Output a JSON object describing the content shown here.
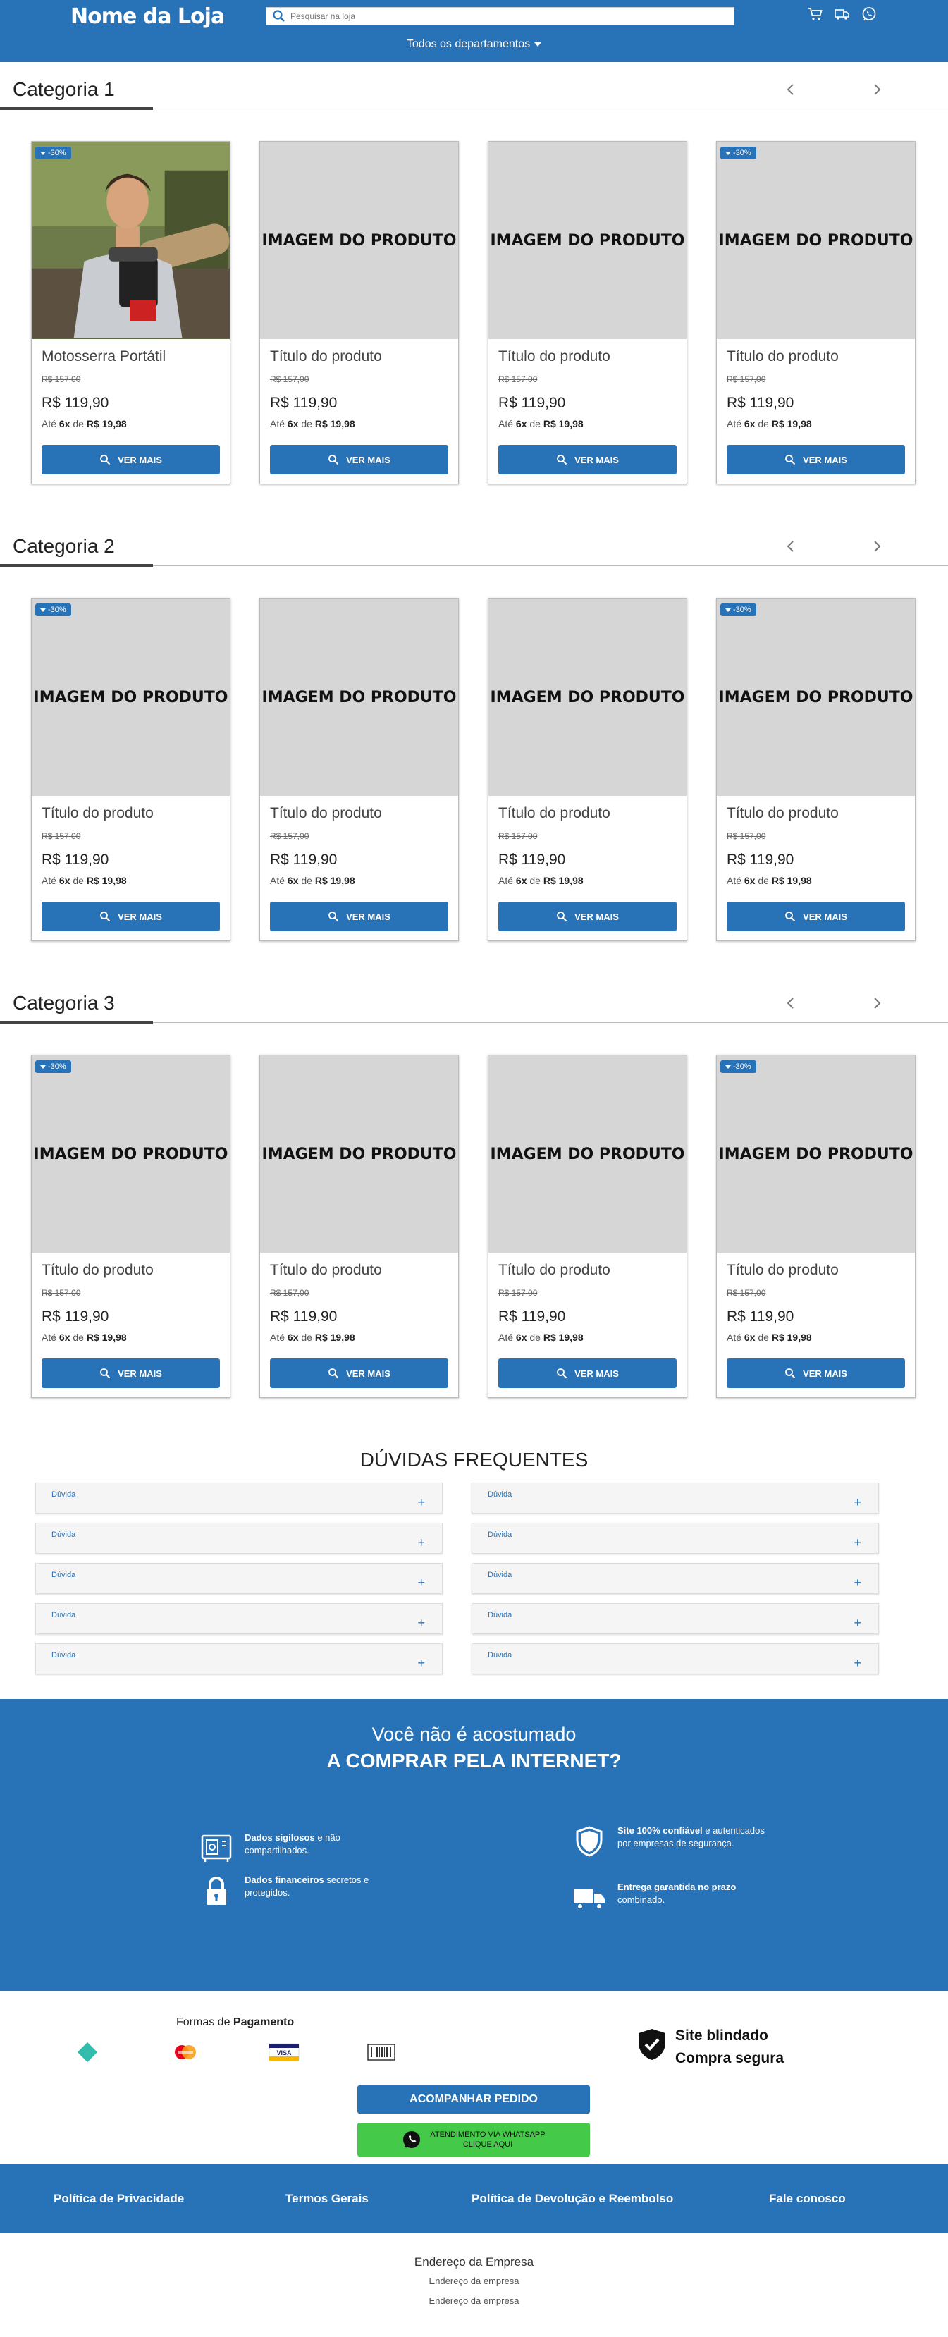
{
  "header": {
    "logo": "Nome da Loja",
    "search_placeholder": "Pesquisar na loja",
    "departments": "Todos os departamentos",
    "icons": [
      "cart-icon",
      "truck-icon",
      "whatsapp-icon"
    ]
  },
  "colors": {
    "primary": "#2873b8",
    "whatsapp": "#44c948",
    "placeholder_bg": "#d6d6d6"
  },
  "categories": [
    {
      "title": "Categoria 1",
      "products": [
        {
          "title": "Motosserra Portátil",
          "image_label": "",
          "badge": "-30%",
          "old_price": "R$ 157,00",
          "price": "R$ 119,90",
          "inst_pre": "Até ",
          "inst_n": "6x",
          "inst_mid": " de ",
          "inst_val": "R$ 19,98",
          "button": "VER MAIS"
        },
        {
          "title": "Título do produto",
          "image_label": "IMAGEM DO PRODUTO",
          "badge": "",
          "old_price": "R$ 157,00",
          "price": "R$ 119,90",
          "inst_pre": "Até ",
          "inst_n": "6x",
          "inst_mid": " de ",
          "inst_val": "R$ 19,98",
          "button": "VER MAIS"
        },
        {
          "title": "Título do produto",
          "image_label": "IMAGEM DO PRODUTO",
          "badge": "",
          "old_price": "R$ 157,00",
          "price": "R$ 119,90",
          "inst_pre": "Até ",
          "inst_n": "6x",
          "inst_mid": " de ",
          "inst_val": "R$ 19,98",
          "button": "VER MAIS"
        },
        {
          "title": "Título do produto",
          "image_label": "IMAGEM DO PRODUTO",
          "badge": "-30%",
          "old_price": "R$ 157,00",
          "price": "R$ 119,90",
          "inst_pre": "Até ",
          "inst_n": "6x",
          "inst_mid": " de ",
          "inst_val": "R$ 19,98",
          "button": "VER MAIS"
        }
      ]
    },
    {
      "title": "Categoria 2",
      "products": [
        {
          "title": "Título do produto",
          "image_label": "IMAGEM DO PRODUTO",
          "badge": "-30%",
          "old_price": "R$ 157,00",
          "price": "R$ 119,90",
          "inst_pre": "Até ",
          "inst_n": "6x",
          "inst_mid": " de ",
          "inst_val": "R$ 19,98",
          "button": "VER MAIS"
        },
        {
          "title": "Título do produto",
          "image_label": "IMAGEM DO PRODUTO",
          "badge": "",
          "old_price": "R$ 157,00",
          "price": "R$ 119,90",
          "inst_pre": "Até ",
          "inst_n": "6x",
          "inst_mid": " de ",
          "inst_val": "R$ 19,98",
          "button": "VER MAIS"
        },
        {
          "title": "Título do produto",
          "image_label": "IMAGEM DO PRODUTO",
          "badge": "",
          "old_price": "R$ 157,00",
          "price": "R$ 119,90",
          "inst_pre": "Até ",
          "inst_n": "6x",
          "inst_mid": " de ",
          "inst_val": "R$ 19,98",
          "button": "VER MAIS"
        },
        {
          "title": "Título do produto",
          "image_label": "IMAGEM DO PRODUTO",
          "badge": "-30%",
          "old_price": "R$ 157,00",
          "price": "R$ 119,90",
          "inst_pre": "Até ",
          "inst_n": "6x",
          "inst_mid": " de ",
          "inst_val": "R$ 19,98",
          "button": "VER MAIS"
        }
      ]
    },
    {
      "title": "Categoria 3",
      "products": [
        {
          "title": "Título do produto",
          "image_label": "IMAGEM DO PRODUTO",
          "badge": "-30%",
          "old_price": "R$ 157,00",
          "price": "R$ 119,90",
          "inst_pre": "Até ",
          "inst_n": "6x",
          "inst_mid": " de ",
          "inst_val": "R$ 19,98",
          "button": "VER MAIS"
        },
        {
          "title": "Título do produto",
          "image_label": "IMAGEM DO PRODUTO",
          "badge": "",
          "old_price": "R$ 157,00",
          "price": "R$ 119,90",
          "inst_pre": "Até ",
          "inst_n": "6x",
          "inst_mid": " de ",
          "inst_val": "R$ 19,98",
          "button": "VER MAIS"
        },
        {
          "title": "Título do produto",
          "image_label": "IMAGEM DO PRODUTO",
          "badge": "",
          "old_price": "R$ 157,00",
          "price": "R$ 119,90",
          "inst_pre": "Até ",
          "inst_n": "6x",
          "inst_mid": " de ",
          "inst_val": "R$ 19,98",
          "button": "VER MAIS"
        },
        {
          "title": "Título do produto",
          "image_label": "IMAGEM DO PRODUTO",
          "badge": "-30%",
          "old_price": "R$ 157,00",
          "price": "R$ 119,90",
          "inst_pre": "Até ",
          "inst_n": "6x",
          "inst_mid": " de ",
          "inst_val": "R$ 19,98",
          "button": "VER MAIS"
        }
      ]
    }
  ],
  "faq": {
    "title": "DÚVIDAS FREQUENTES",
    "left": [
      "Dúvida",
      "Dúvida",
      "Dúvida",
      "Dúvida",
      "Dúvida"
    ],
    "right": [
      "Dúvida",
      "Dúvida",
      "Dúvida",
      "Dúvida",
      "Dúvida"
    ],
    "toggle": "+"
  },
  "trust": {
    "line1": "Você não é acostumado",
    "line2": "A COMPRAR PELA INTERNET?",
    "features": [
      {
        "icon": "safe-icon",
        "bold": "Dados sigilosos",
        "text": " e não compartilhados."
      },
      {
        "icon": "lock-icon",
        "bold": "Dados financeiros",
        "text": " secretos e protegidos."
      },
      {
        "icon": "shield-check-icon",
        "bold": "Site 100% confiável",
        "text": " e autenticados por empresas de segurança."
      },
      {
        "icon": "truck-icon",
        "bold": "Entrega garantida no prazo",
        "text": " combinado."
      }
    ]
  },
  "payment": {
    "title_pre": "Formas de ",
    "title_bold": "Pagamento",
    "icons": [
      "pix-icon",
      "mastercard-icon",
      "visa-icon",
      "boleto-icon"
    ],
    "visa_label": "VISA"
  },
  "security": {
    "line1": "Site blindado",
    "line2": "Compra segura"
  },
  "actions": {
    "track": "ACOMPANHAR PEDIDO",
    "whatsapp_line1": "ATENDIMENTO VIA WHATSAPP",
    "whatsapp_line2": "CLIQUE AQUI"
  },
  "footer_links": [
    "Política de Privacidade",
    "Termos Gerais",
    "Política de Devolução e Reembolso",
    "Fale conosco"
  ],
  "address": {
    "title": "Endereço da Empresa",
    "line1": "Endereço da empresa",
    "line2": "Endereço da empresa"
  }
}
